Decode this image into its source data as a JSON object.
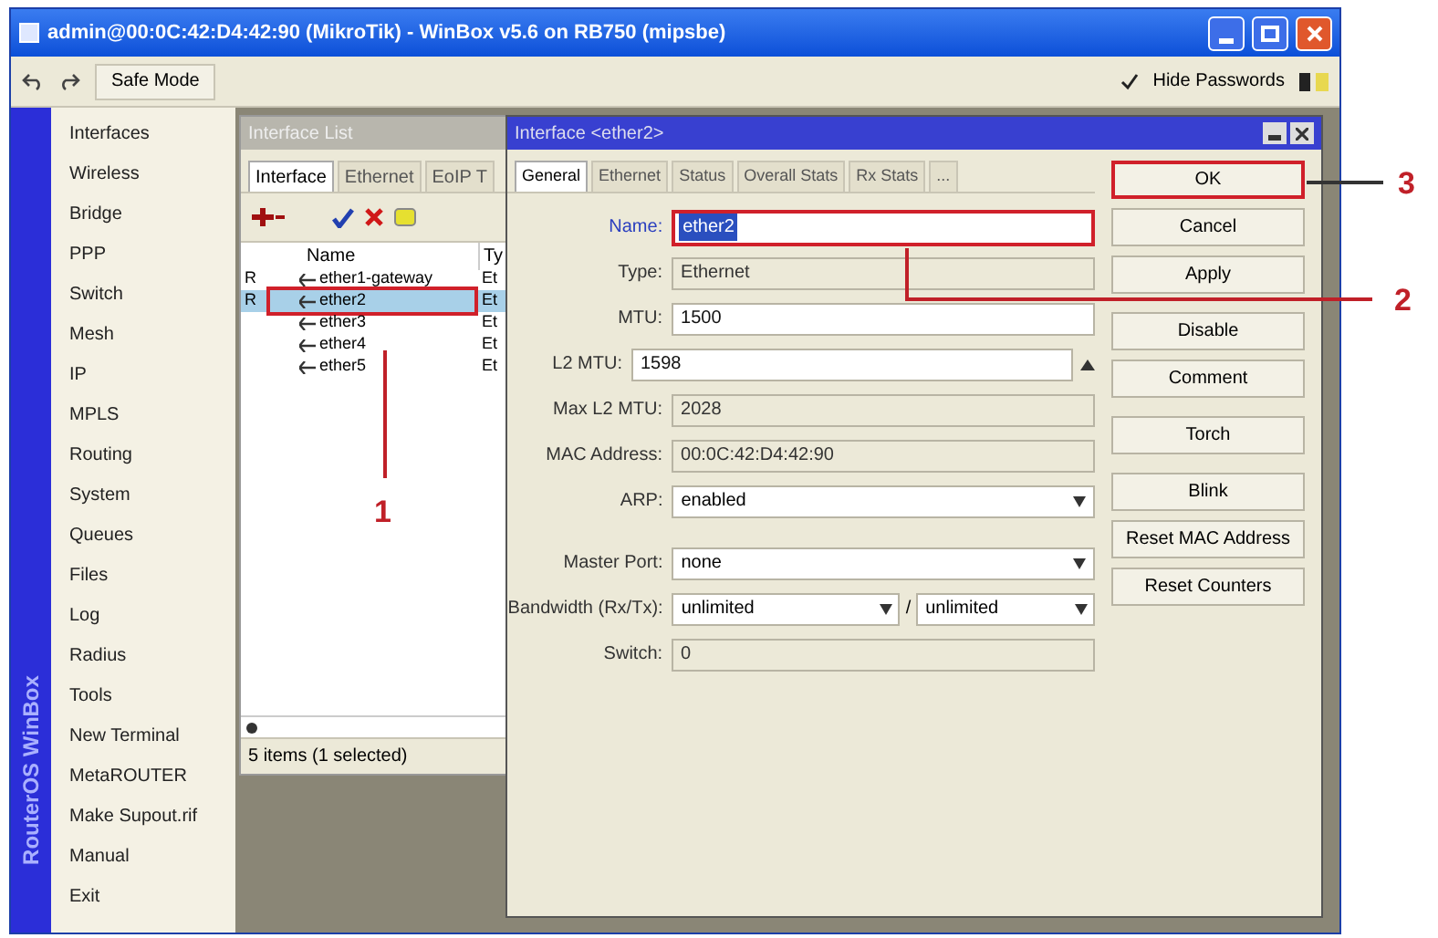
{
  "window": {
    "title": "admin@00:0C:42:D4:42:90 (MikroTik) - WinBox v5.6 on RB750 (mipsbe)"
  },
  "toolbar": {
    "safe_mode": "Safe Mode",
    "hide_passwords": {
      "label": "Hide Passwords",
      "checked": true
    }
  },
  "brand": "RouterOS WinBox",
  "sidebar": {
    "items": [
      "Interfaces",
      "Wireless",
      "Bridge",
      "PPP",
      "Switch",
      "Mesh",
      "IP",
      "MPLS",
      "Routing",
      "System",
      "Queues",
      "Files",
      "Log",
      "Radius",
      "Tools",
      "New Terminal",
      "MetaROUTER",
      "Make Supout.rif",
      "Manual",
      "Exit"
    ]
  },
  "interface_list": {
    "title": "Interface List",
    "tabs": [
      {
        "label": "Interface",
        "selected": true
      },
      {
        "label": "Ethernet",
        "selected": false
      },
      {
        "label": "EoIP T",
        "selected": false
      }
    ],
    "columns": [
      "Name",
      "Ty"
    ],
    "rows": [
      {
        "flag": "R",
        "name": "ether1-gateway",
        "type": "Et",
        "selected": false,
        "annotated": false
      },
      {
        "flag": "R",
        "name": "ether2",
        "type": "Et",
        "selected": true,
        "annotated": true
      },
      {
        "flag": "",
        "name": "ether3",
        "type": "Et",
        "selected": false,
        "annotated": false
      },
      {
        "flag": "",
        "name": "ether4",
        "type": "Et",
        "selected": false,
        "annotated": false
      },
      {
        "flag": "",
        "name": "ether5",
        "type": "Et",
        "selected": false,
        "annotated": false
      }
    ],
    "status": "5 items (1 selected)"
  },
  "dialog": {
    "title": "Interface <ether2>",
    "tabs": [
      {
        "label": "General",
        "selected": true
      },
      {
        "label": "Ethernet",
        "selected": false
      },
      {
        "label": "Status",
        "selected": false
      },
      {
        "label": "Overall Stats",
        "selected": false
      },
      {
        "label": "Rx Stats",
        "selected": false
      },
      {
        "label": "...",
        "selected": false
      }
    ],
    "fields": [
      {
        "kind": "input",
        "label": "Name:",
        "value": "ether2",
        "annotated": true
      },
      {
        "kind": "readonly",
        "label": "Type:",
        "value": "Ethernet",
        "annotated": false
      },
      {
        "kind": "input",
        "label": "MTU:",
        "value": "1500",
        "annotated": false
      },
      {
        "kind": "collapse",
        "label": "L2 MTU:",
        "value": "1598",
        "annotated": false
      },
      {
        "kind": "readonly",
        "label": "Max L2 MTU:",
        "value": "2028",
        "annotated": false
      },
      {
        "kind": "readonly",
        "label": "MAC Address:",
        "value": "00:0C:42:D4:42:90",
        "annotated": false
      },
      {
        "kind": "dropdown",
        "label": "ARP:",
        "value": "enabled",
        "annotated": false
      },
      {
        "kind": "gap"
      },
      {
        "kind": "dropdown",
        "label": "Master Port:",
        "value": "none",
        "annotated": false
      },
      {
        "kind": "dual",
        "label": "Bandwidth (Rx/Tx):",
        "value": "unlimited",
        "value2": "unlimited",
        "separator": "/",
        "annotated": false
      },
      {
        "kind": "readonly",
        "label": "Switch:",
        "value": "0",
        "annotated": false
      }
    ],
    "button_groups": [
      [
        {
          "label": "OK",
          "annotated": true
        },
        {
          "label": "Cancel",
          "annotated": false
        },
        {
          "label": "Apply",
          "annotated": false
        }
      ],
      [
        {
          "label": "Disable",
          "annotated": false
        },
        {
          "label": "Comment",
          "annotated": false
        }
      ],
      [
        {
          "label": "Torch",
          "annotated": false
        }
      ],
      [
        {
          "label": "Blink",
          "annotated": false
        },
        {
          "label": "Reset MAC Address",
          "annotated": false
        },
        {
          "label": "Reset Counters",
          "annotated": false
        }
      ]
    ]
  },
  "annotations": [
    "1",
    "2",
    "3"
  ]
}
